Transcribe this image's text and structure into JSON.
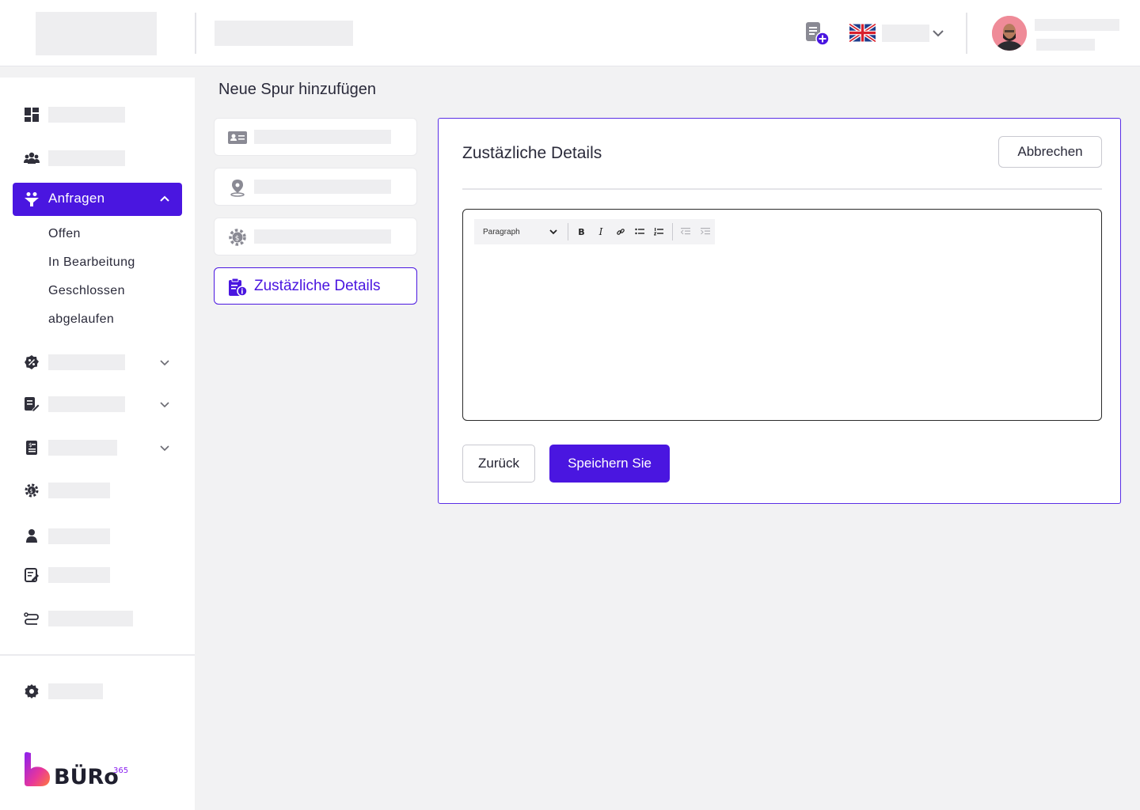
{
  "header": {
    "language_flag": "uk-flag-icon",
    "add_document_icon": "document-add-icon",
    "language_chevron": "chevron-down-icon"
  },
  "sidebar": {
    "active_item": {
      "label": "Anfragen",
      "icon": "funnel-users-icon"
    },
    "sub_items": [
      "Offen",
      "In Bearbeitung",
      "Geschlossen",
      "abgelaufen"
    ],
    "brand": {
      "name": "BÜRo",
      "superscript": "365"
    }
  },
  "main": {
    "page_title": "Neue Spur hinzufügen",
    "steps": {
      "active_label": "Zustäzliche Details"
    },
    "card": {
      "title": "Zustäzliche Details",
      "cancel_label": "Abbrechen",
      "editor": {
        "paragraph_label": "Paragraph",
        "bold": "B",
        "italic": "I"
      },
      "back_label": "Zurück",
      "save_label": "Speichern Sie"
    }
  },
  "colors": {
    "accent": "#4a16e0",
    "background": "#f2f2f3"
  }
}
